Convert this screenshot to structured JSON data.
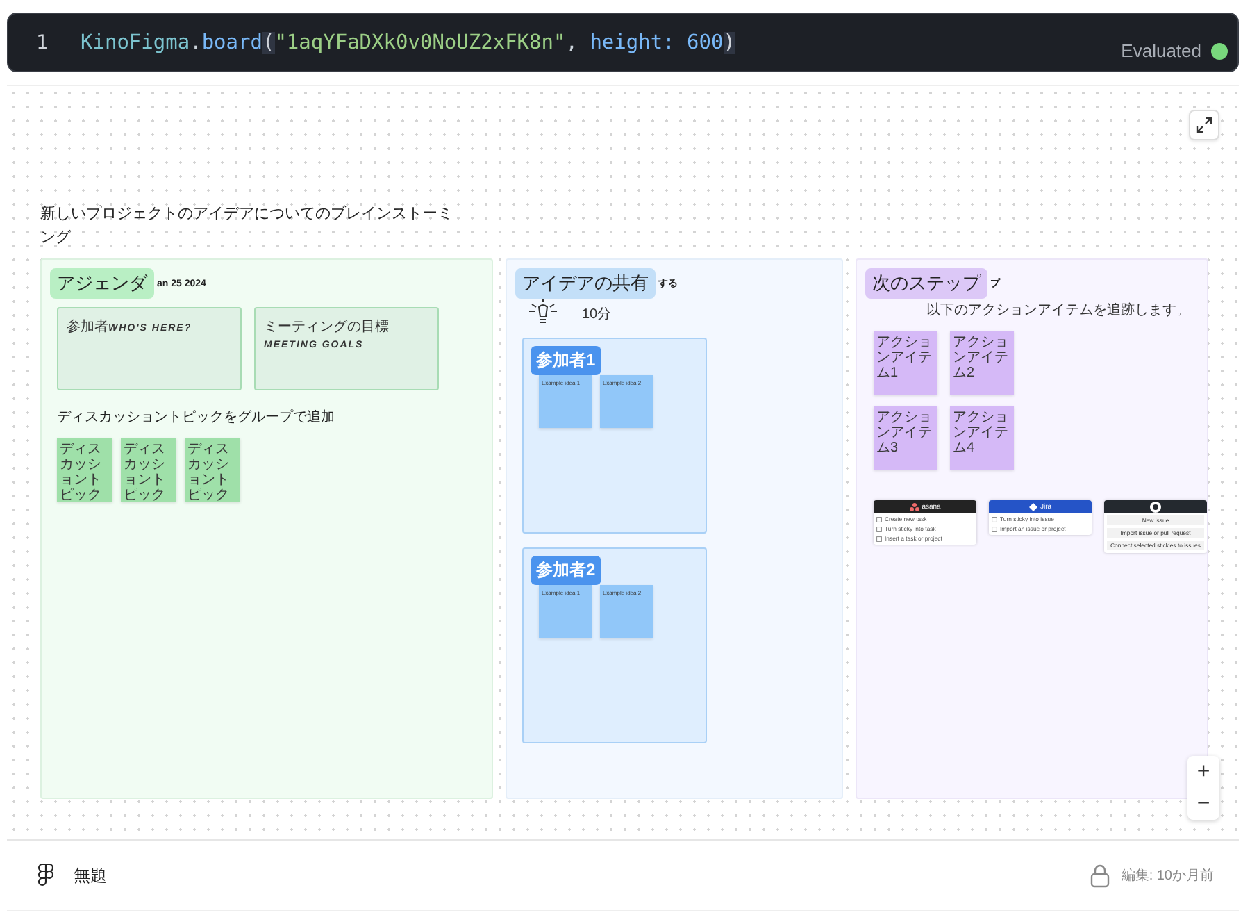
{
  "cell": {
    "line_number": "1",
    "code": [
      {
        "kind": "module",
        "text": "KinoFigma"
      },
      {
        "kind": "punct",
        "text": "."
      },
      {
        "kind": "func",
        "text": "board"
      },
      {
        "kind": "paren",
        "text": "("
      },
      {
        "kind": "string",
        "text": "\"1aqYFaDXk0v0NoUZ2xFK8n\""
      },
      {
        "kind": "punct",
        "text": ", "
      },
      {
        "kind": "key",
        "text": "height: "
      },
      {
        "kind": "number",
        "text": "600"
      },
      {
        "kind": "paren",
        "text": ")"
      }
    ],
    "status": "Evaluated",
    "evaluated": true
  },
  "board": {
    "title": "新しいプロジェクトのアイデアについてのブレインストーミング",
    "sections": [
      {
        "kind": "agenda",
        "tag": "アジェンダ",
        "color": "#b9efc4",
        "header_text": "an 25 2024",
        "boxes": [
          {
            "label": "参加者",
            "handwritten": "WHO'S HERE?"
          },
          {
            "label": "ミーティングの目標",
            "handwritten": "MEETING GOALS"
          }
        ],
        "topics_label": "ディスカッショントピックをグループで追加",
        "stickies": [
          "ディスカッショントピック",
          "ディスカッショントピック",
          "ディスカッショントピック"
        ]
      },
      {
        "kind": "ideas",
        "tag": "アイデアの共有",
        "color": "#c3dff8",
        "header_text": "する",
        "duration": "10分",
        "participants": [
          {
            "name": "参加者1",
            "stickies": [
              "Example idea 1",
              "Example idea 2"
            ]
          },
          {
            "name": "参加者2",
            "stickies": [
              "Example idea 1",
              "Example idea 2"
            ]
          }
        ]
      },
      {
        "kind": "next_steps",
        "tag": "次のステップ",
        "color": "#dcc8f7",
        "header_text": "プ",
        "subtitle": "以下のアクションアイテムを追跡します。",
        "stickies": [
          "アクションアイテム1",
          "アクションアイテム2",
          "アクションアイテム3",
          "アクションアイテム4"
        ],
        "integrations": [
          {
            "kind": "asana",
            "header": "asana",
            "actions": [
              "Create new task",
              "Turn sticky into task",
              "Insert a task or project"
            ]
          },
          {
            "kind": "jira",
            "header": "Jira",
            "actions": [
              "Turn sticky into issue",
              "Import an issue or project"
            ]
          },
          {
            "kind": "github",
            "actions": [
              "New issue",
              "Import issue or pull request",
              "Connect selected stickies to issues"
            ]
          }
        ]
      }
    ]
  },
  "zoom": {
    "zoom_in": "+",
    "zoom_out": "−"
  },
  "footer": {
    "file_name": "無題",
    "edited": "編集: 10か月前"
  }
}
